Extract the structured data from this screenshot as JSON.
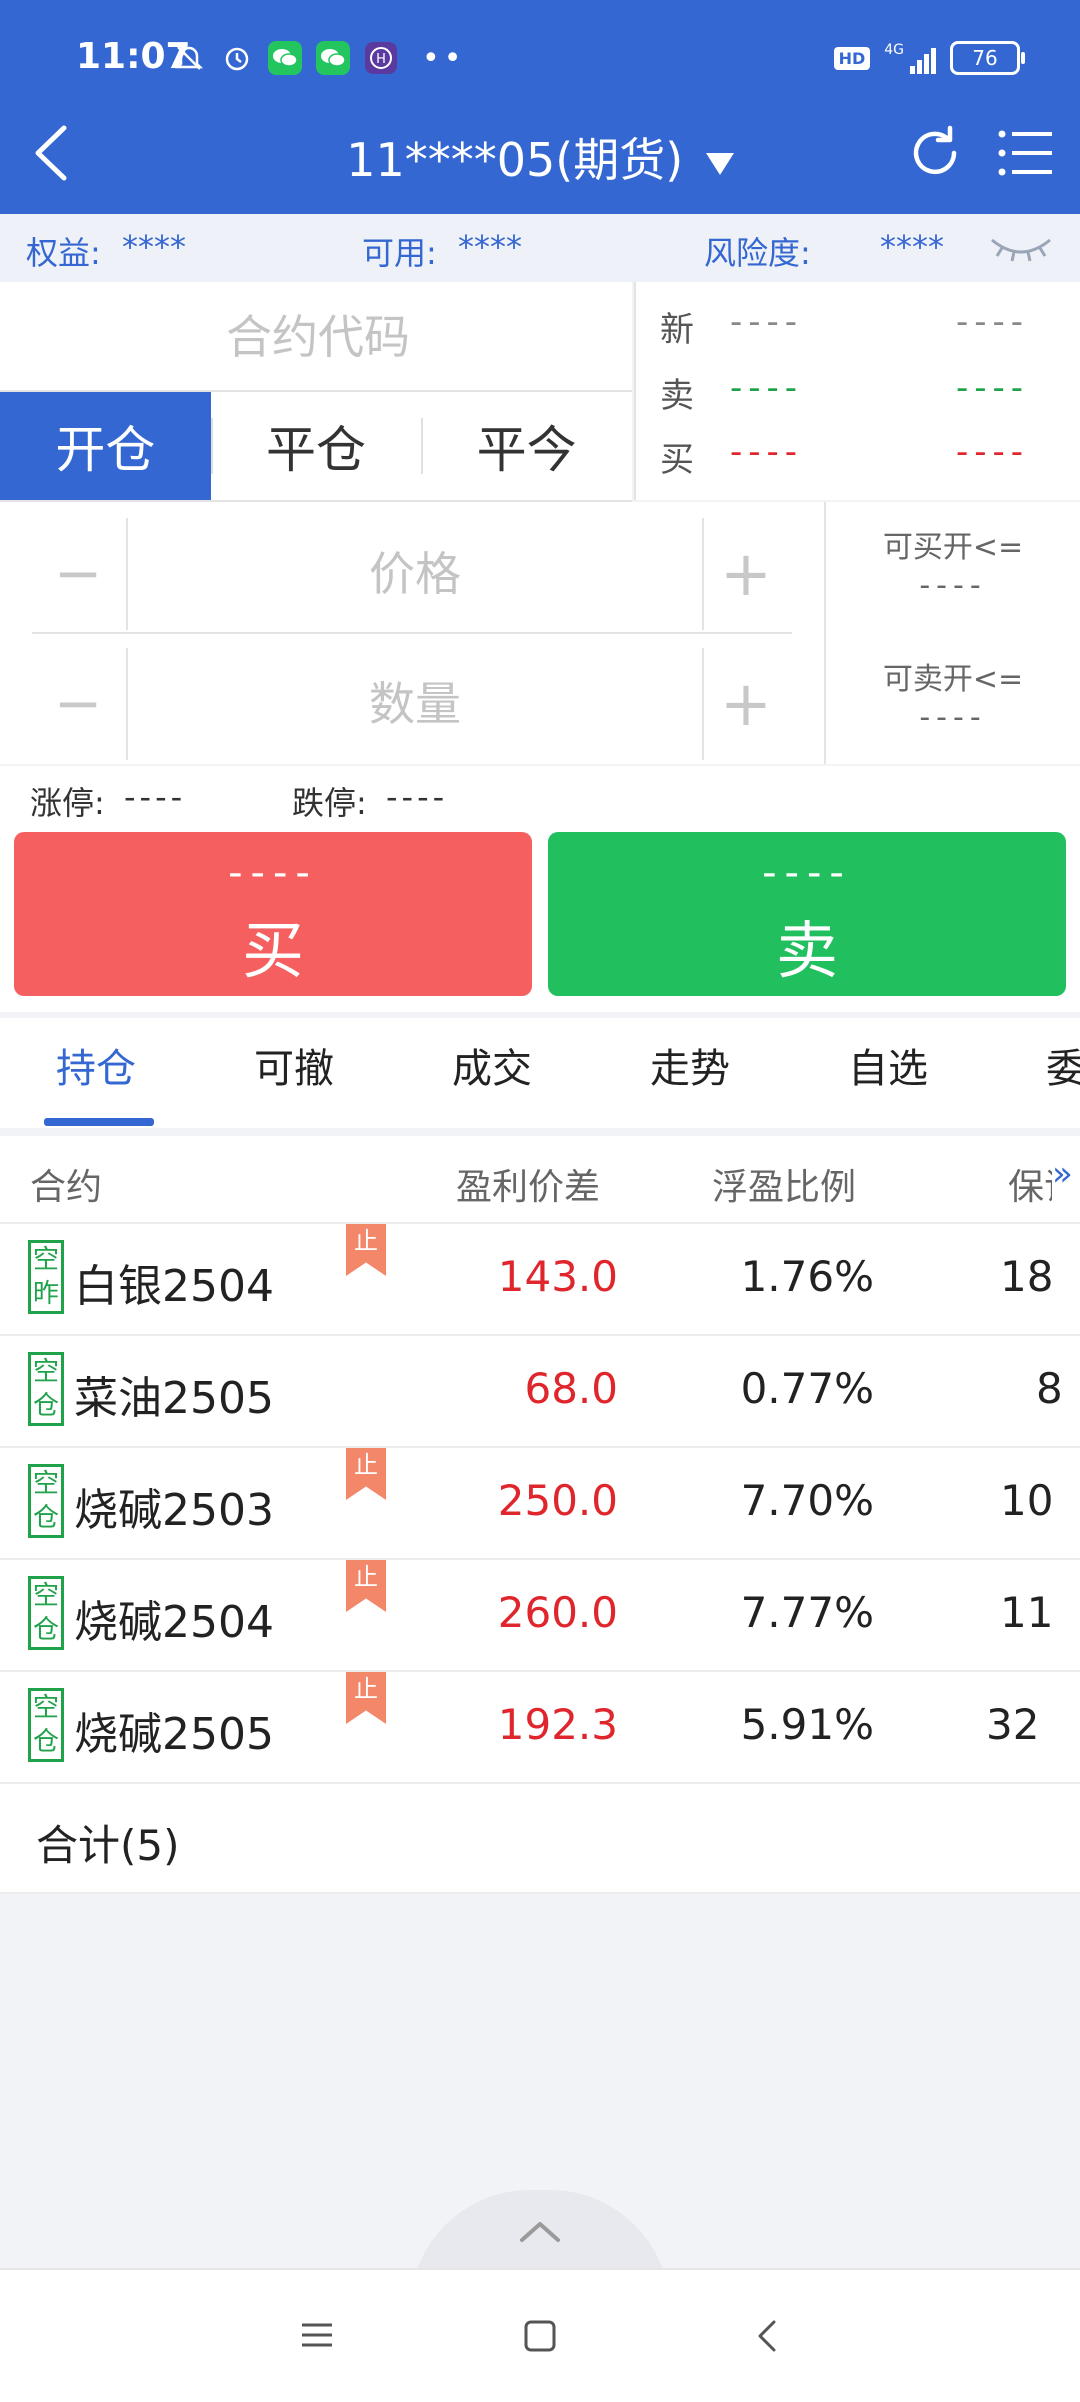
{
  "status": {
    "time": "11:07",
    "network": "4G",
    "battery": "76",
    "hd": "HD"
  },
  "header": {
    "title": "11****05(期货)"
  },
  "account": {
    "equity_label": "权益:",
    "equity_value": "****",
    "available_label": "可用:",
    "available_value": "****",
    "risk_label": "风险度:",
    "risk_value": "****"
  },
  "contract": {
    "placeholder": "合约代码"
  },
  "quote": {
    "rows": [
      {
        "label": "新",
        "v1": "----",
        "v2": "----",
        "color": "#888888"
      },
      {
        "label": "卖",
        "v1": "----",
        "v2": "----",
        "color": "#1fa24a"
      },
      {
        "label": "买",
        "v1": "----",
        "v2": "----",
        "color": "#e0262d"
      }
    ]
  },
  "order_tabs": [
    "开仓",
    "平仓",
    "平今"
  ],
  "price": {
    "placeholder": "价格",
    "minus": "−",
    "plus": "+"
  },
  "quantity": {
    "placeholder": "数量",
    "minus": "−",
    "plus": "+"
  },
  "side_info": {
    "buy_open_label": "可买开<=",
    "buy_open_value": "----",
    "sell_open_label": "可卖开<=",
    "sell_open_value": "----"
  },
  "limits": {
    "up_label": "涨停:",
    "up_value": "----",
    "down_label": "跌停:",
    "down_value": "----"
  },
  "buttons": {
    "buy_price": "----",
    "buy_label": "买",
    "sell_price": "----",
    "sell_label": "卖"
  },
  "list_tabs": [
    "持仓",
    "可撤",
    "成交",
    "走势",
    "自选",
    "委"
  ],
  "table": {
    "headers": {
      "contract": "合约",
      "profit": "盈利价差",
      "ratio": "浮盈比例",
      "margin": "保证"
    },
    "rows": [
      {
        "badge_top": "空",
        "badge_bottom": "昨",
        "name": "白银2504",
        "stop": "止",
        "profit": "143.0",
        "ratio": "1.76%",
        "margin": "18"
      },
      {
        "badge_top": "空",
        "badge_bottom": "仓",
        "name": "菜油2505",
        "stop": "",
        "profit": "68.0",
        "ratio": "0.77%",
        "margin": "8"
      },
      {
        "badge_top": "空",
        "badge_bottom": "仓",
        "name": "烧碱2503",
        "stop": "止",
        "profit": "250.0",
        "ratio": "7.70%",
        "margin": "10"
      },
      {
        "badge_top": "空",
        "badge_bottom": "仓",
        "name": "烧碱2504",
        "stop": "止",
        "profit": "260.0",
        "ratio": "7.77%",
        "margin": "11"
      },
      {
        "badge_top": "空",
        "badge_bottom": "仓",
        "name": "烧碱2505",
        "stop": "止",
        "profit": "192.3",
        "ratio": "5.91%",
        "margin": "32"
      }
    ],
    "total": "合计(5)"
  },
  "colors": {
    "brand": "#3467d1",
    "buy": "#f55f5f",
    "sell": "#22bf5e",
    "profit": "#e0262d"
  }
}
